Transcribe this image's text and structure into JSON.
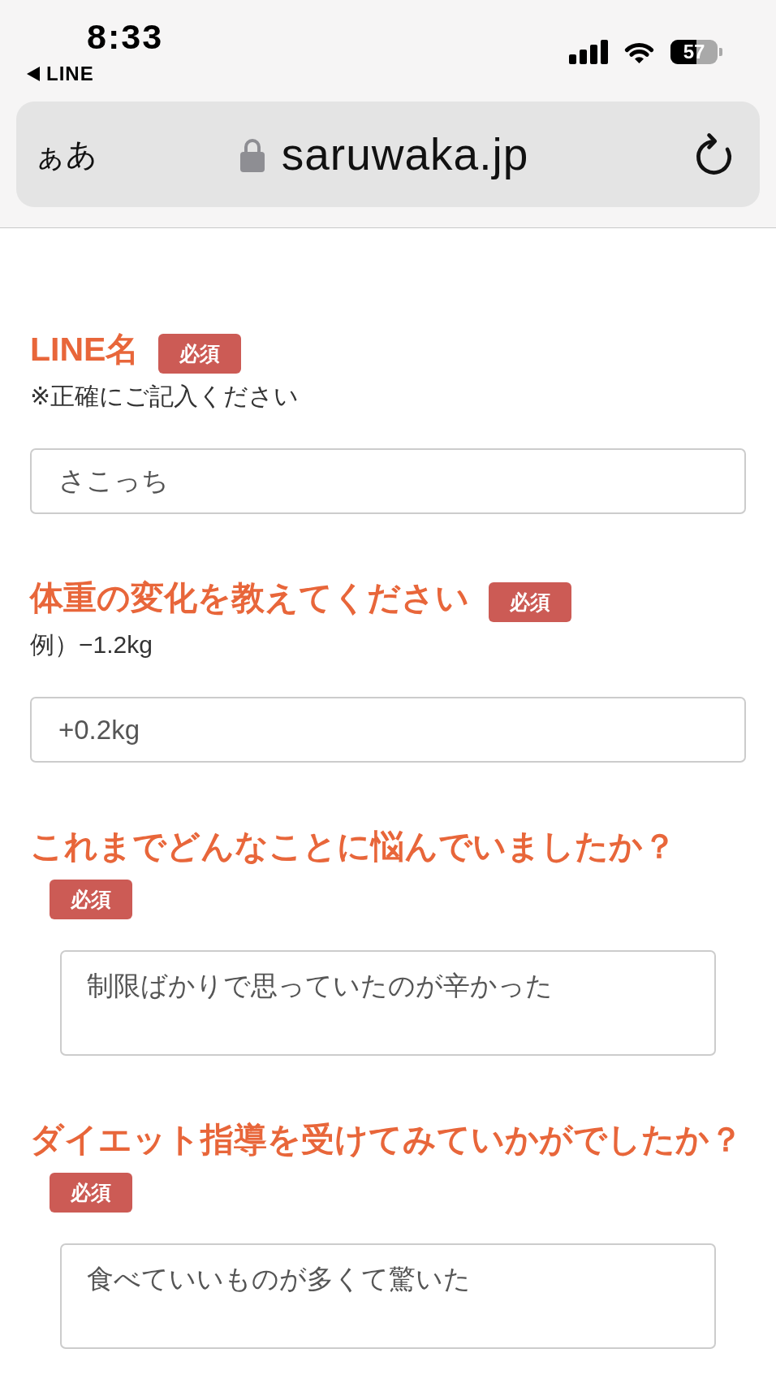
{
  "status_bar": {
    "time": "8:33",
    "back_label": "LINE",
    "battery": "57"
  },
  "address_bar": {
    "text_size_button": "ぁあ",
    "domain": "saruwaka.jp"
  },
  "form": {
    "fields": [
      {
        "kind": "input",
        "label": "LINE名",
        "badge": "必須",
        "hint": "※正確にご記入ください",
        "value": "さこっち"
      },
      {
        "kind": "input",
        "label": "体重の変化を教えてください",
        "badge": "必須",
        "hint": "例）−1.2kg",
        "value": "+0.2kg"
      },
      {
        "kind": "textarea",
        "label": "これまでどんなことに悩んでいましたか？",
        "badge": "必須",
        "value": "制限ばかりで思っていたのが辛かった"
      },
      {
        "kind": "textarea",
        "label": "ダイエット指導を受けてみていかがでしたか？",
        "badge": "必須",
        "value": "食べていいものが多くて驚いた"
      }
    ]
  }
}
